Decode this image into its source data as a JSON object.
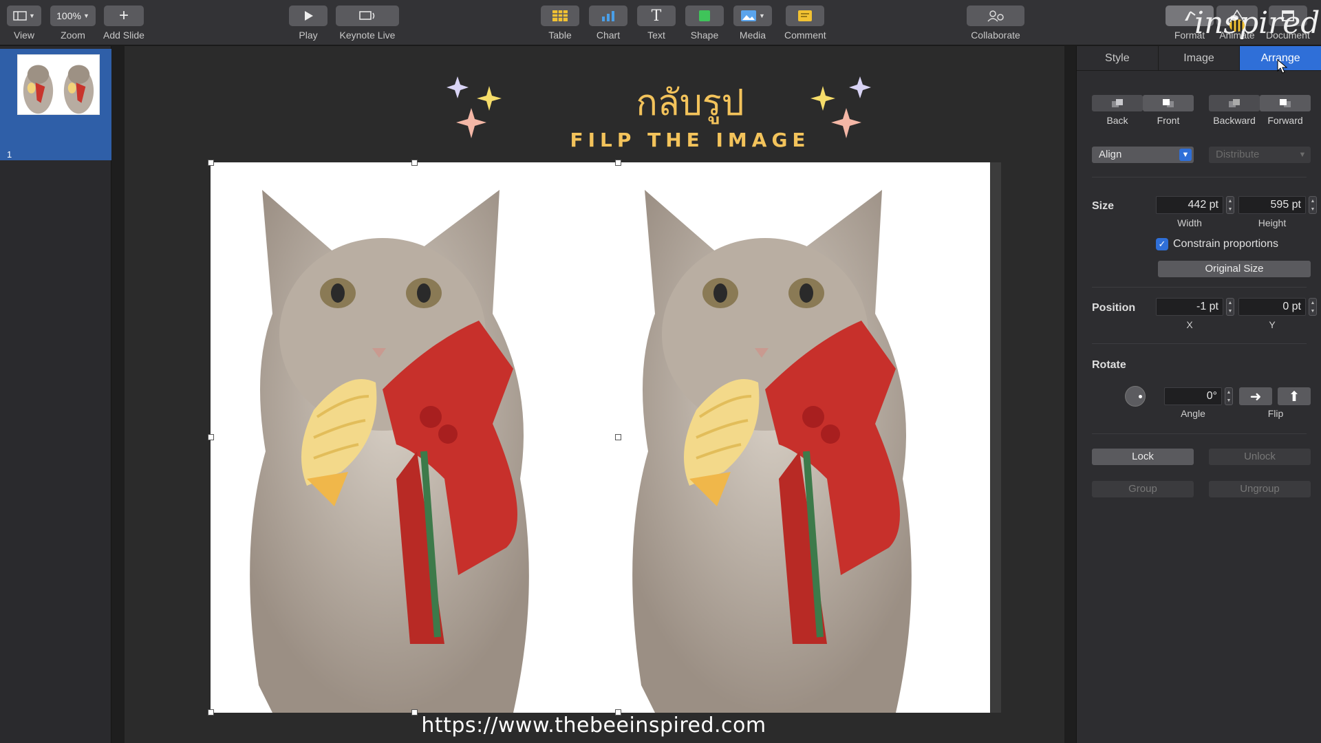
{
  "toolbar": {
    "view_label": "View",
    "zoom_value": "100%",
    "zoom_label": "Zoom",
    "add_slide_label": "Add Slide",
    "play_label": "Play",
    "keynote_live_label": "Keynote Live",
    "table_label": "Table",
    "chart_label": "Chart",
    "text_label": "Text",
    "shape_label": "Shape",
    "media_label": "Media",
    "comment_label": "Comment",
    "collaborate_label": "Collaborate",
    "format_label": "Format",
    "animate_label": "Animate",
    "document_label": "Document"
  },
  "navigator": {
    "slide_number": "1"
  },
  "slide": {
    "title_thai": "กลับรูป",
    "title_english": "FILP THE IMAGE",
    "url": "https://www.thebeeinspired.com",
    "watermark": "inspired"
  },
  "inspector": {
    "tabs": [
      "Style",
      "Image",
      "Arrange"
    ],
    "active_tab": "Arrange",
    "back_label": "Back",
    "front_label": "Front",
    "backward_label": "Backward",
    "forward_label": "Forward",
    "align_label": "Align",
    "distribute_label": "Distribute",
    "size_label": "Size",
    "width_value": "442 pt",
    "width_label": "Width",
    "height_value": "595 pt",
    "height_label": "Height",
    "constrain_label": "Constrain proportions",
    "constrain_checked": true,
    "original_size_label": "Original Size",
    "position_label": "Position",
    "x_value": "-1 pt",
    "x_label": "X",
    "y_value": "0 pt",
    "y_label": "Y",
    "rotate_label": "Rotate",
    "angle_value": "0°",
    "angle_label": "Angle",
    "flip_label": "Flip",
    "lock_label": "Lock",
    "unlock_label": "Unlock",
    "group_label": "Group",
    "ungroup_label": "Ungroup"
  },
  "colors": {
    "accent": "#2f6fd8",
    "title_gold": "#f3c35b",
    "star_lavender": "#d9d4f5",
    "star_yellow": "#f6dd6a",
    "star_pink": "#f4b7a6"
  }
}
